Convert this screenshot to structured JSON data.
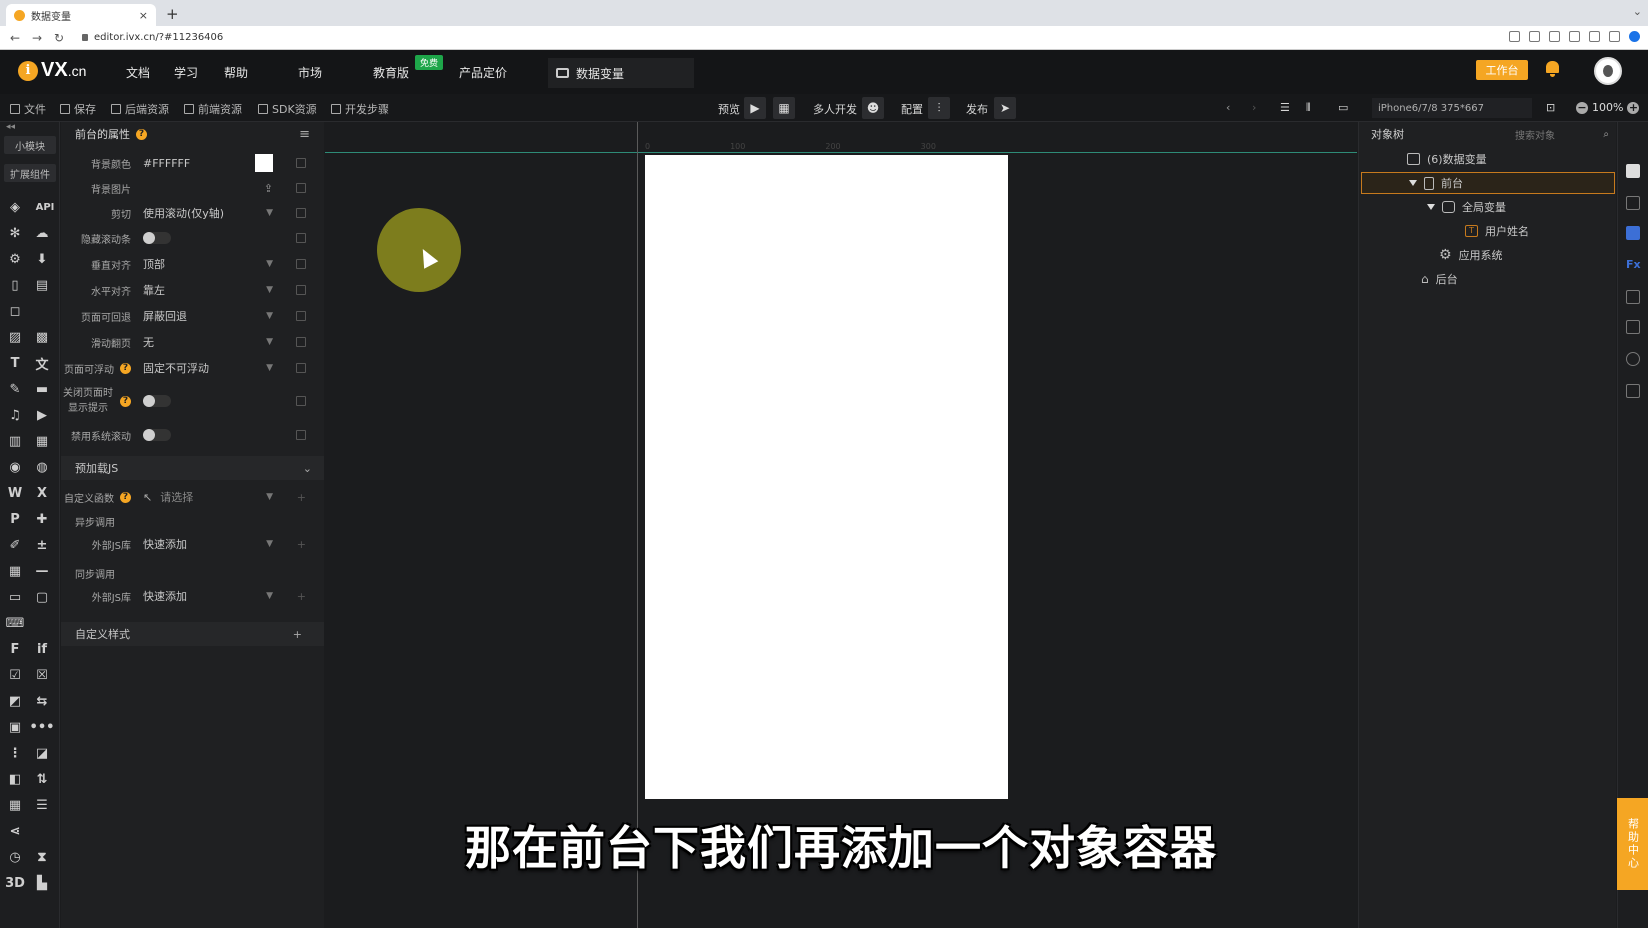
{
  "browser": {
    "tab_title": "数据变量",
    "url": "editor.ivx.cn/?#11236406"
  },
  "topnav": {
    "logo_text": "VX",
    "logo_suffix": ".cn",
    "items": [
      "文档",
      "学习",
      "帮助",
      "市场",
      "教育版",
      "产品定价"
    ],
    "edu_badge": "免费",
    "doc_tab": "数据变量",
    "work_button": "工作台"
  },
  "toolbar": {
    "left": [
      "文件",
      "保存",
      "后端资源",
      "前端资源",
      "SDK资源",
      "开发步骤"
    ],
    "preview_label": "预览",
    "multi_label": "多人开发",
    "config_label": "配置",
    "publish_label": "发布",
    "device": "iPhone6/7/8 375*667",
    "zoom": "100%"
  },
  "rail": {
    "tab_small": "小模块",
    "tab_ext": "扩展组件",
    "api_label": "API"
  },
  "props": {
    "title": "前台的属性",
    "rows": [
      {
        "label": "背景颜色",
        "value": "#FFFFFF"
      },
      {
        "label": "背景图片",
        "value": ""
      },
      {
        "label": "剪切",
        "value": "使用滚动(仅y轴)"
      },
      {
        "label": "隐藏滚动条",
        "value": ""
      },
      {
        "label": "垂直对齐",
        "value": "顶部"
      },
      {
        "label": "水平对齐",
        "value": "靠左"
      },
      {
        "label": "页面可回退",
        "value": "屏蔽回退"
      },
      {
        "label": "滑动翻页",
        "value": "无"
      },
      {
        "label": "页面可浮动",
        "value": "固定不可浮动"
      },
      {
        "label": "关闭页面时显示提示",
        "value": ""
      },
      {
        "label": "禁用系统滚动",
        "value": ""
      }
    ],
    "preload_section": "预加载JS",
    "custom_func_label": "自定义函数",
    "custom_func_placeholder": "请选择",
    "async_label": "异步调用",
    "ext_js_label": "外部JS库",
    "ext_js_value": "快速添加",
    "sync_label": "同步调用",
    "ext_js_label2": "外部JS库",
    "ext_js_value2": "快速添加",
    "custom_style_section": "自定义样式"
  },
  "canvas": {
    "ruler_ticks": [
      "0",
      "100",
      "200",
      "300"
    ],
    "caption": "那在前台下我们再添加一个对象容器"
  },
  "tree": {
    "title": "对象树",
    "search_placeholder": "搜索对象",
    "nodes": [
      {
        "label": "(6)数据变量"
      },
      {
        "label": "前台"
      },
      {
        "label": "全局变量"
      },
      {
        "label": "用户姓名"
      },
      {
        "label": "应用系统"
      },
      {
        "label": "后台"
      }
    ]
  },
  "helpbar": "帮助中心",
  "colors": {
    "accent": "#f5a623",
    "selection_border": "#c77a1d",
    "canvas_line": "#2e8b77"
  }
}
